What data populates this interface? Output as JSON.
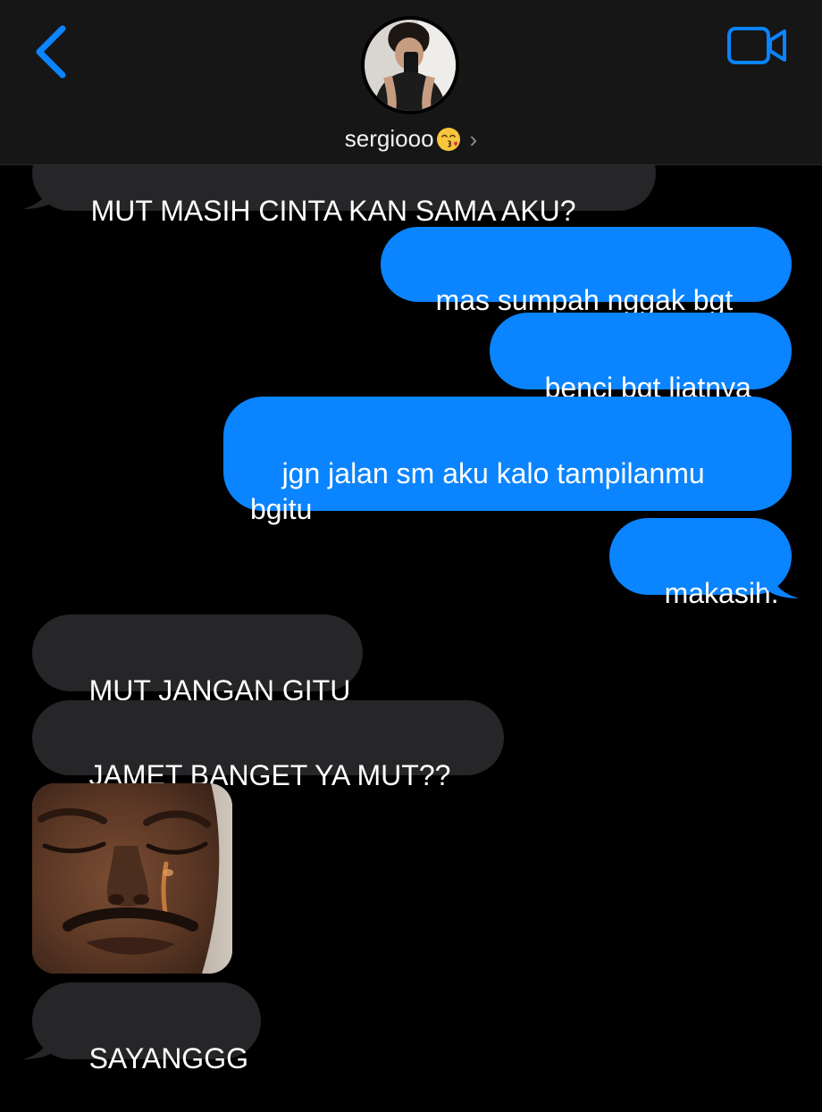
{
  "header": {
    "contact_name": "sergiooo",
    "contact_emoji": "kissing-face-emoji",
    "icons": {
      "back": "chevron-left-icon",
      "video": "video-camera-icon",
      "disclosure": "chevron-right-icon"
    },
    "accent_color": "#0a84ff"
  },
  "messages": [
    {
      "direction": "incoming",
      "text": "MUT MASIH CINTA KAN SAMA AKU?",
      "partially_hidden": true
    },
    {
      "direction": "outgoing",
      "text": "mas sumpah nggak bgt"
    },
    {
      "direction": "outgoing",
      "text": "benci bgt liatnya"
    },
    {
      "direction": "outgoing",
      "text": "jgn jalan sm aku kalo tampilanmu bgitu"
    },
    {
      "direction": "outgoing",
      "text": "makasih."
    },
    {
      "direction": "incoming",
      "text": "MUT JANGAN GITU"
    },
    {
      "direction": "incoming",
      "text": "JAMET BANGET YA MUT??"
    },
    {
      "direction": "incoming",
      "type": "image",
      "content": "crying-face-photo"
    },
    {
      "direction": "incoming",
      "text": "SAYANGGG"
    }
  ],
  "colors": {
    "incoming_bubble": "#262628",
    "outgoing_bubble": "#0a84ff",
    "header_bg": "#161616",
    "background": "#000000"
  }
}
